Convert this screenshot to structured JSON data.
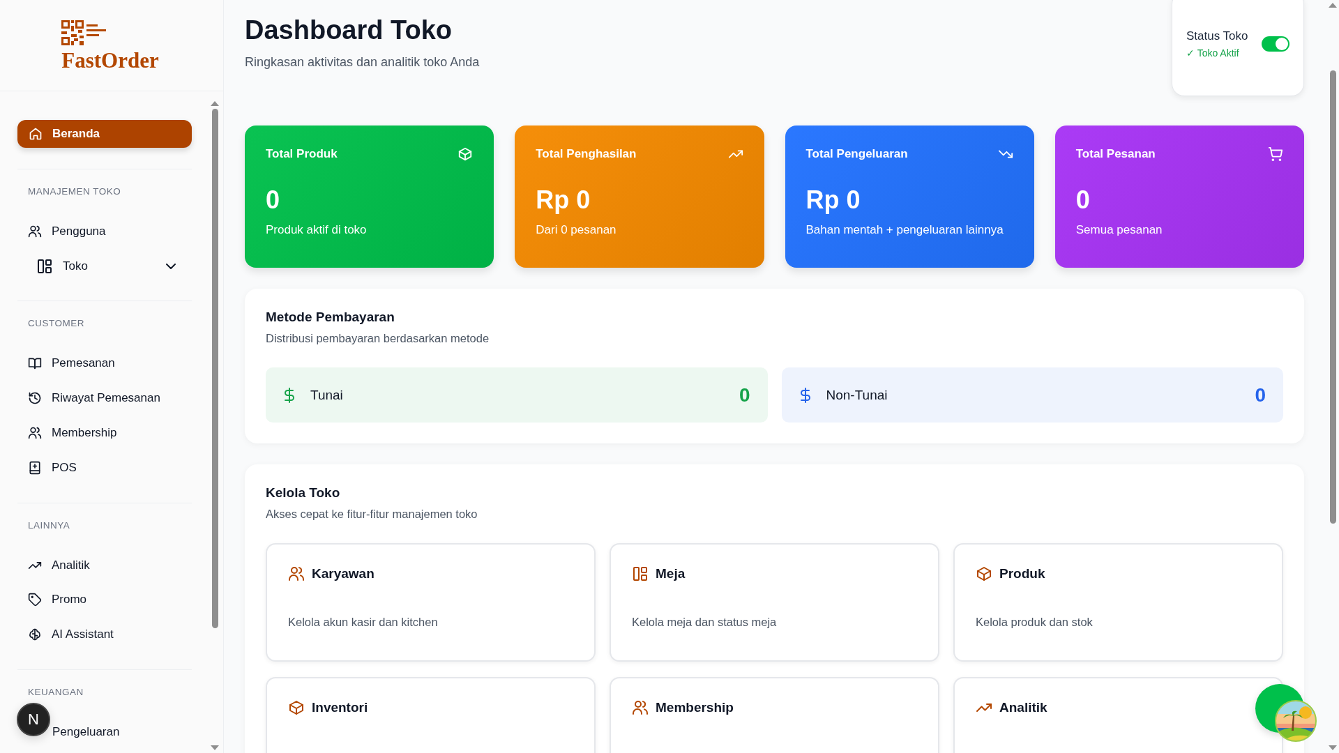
{
  "brand": {
    "name": "FastOrder"
  },
  "sidebar": {
    "home": {
      "label": "Beranda",
      "selected": true
    },
    "sections": [
      {
        "heading": "MANAJEMEN TOKO",
        "items": [
          {
            "kind": "link",
            "label": "Pengguna",
            "selected": false
          },
          {
            "kind": "group",
            "label": "Toko",
            "selected": false,
            "expanded": false
          }
        ]
      },
      {
        "heading": "CUSTOMER",
        "items": [
          {
            "kind": "link",
            "label": "Pemesanan",
            "selected": false
          },
          {
            "kind": "link",
            "label": "Riwayat Pemesanan",
            "selected": false
          },
          {
            "kind": "link",
            "label": "Membership",
            "selected": false
          },
          {
            "kind": "link",
            "label": "POS",
            "selected": false
          }
        ]
      },
      {
        "heading": "LAINNYA",
        "items": [
          {
            "kind": "link",
            "label": "Analitik",
            "selected": false
          },
          {
            "kind": "link",
            "label": "Promo",
            "selected": false
          },
          {
            "kind": "link",
            "label": "AI Assistant",
            "selected": false
          }
        ]
      },
      {
        "heading": "KEUANGAN",
        "items": [
          {
            "kind": "link",
            "label": "Pengeluaran",
            "selected": false
          }
        ]
      }
    ]
  },
  "header": {
    "title": "Dashboard Toko",
    "subtitle": "Ringkasan aktivitas dan analitik toko Anda"
  },
  "store_status": {
    "label": "Status Toko",
    "status": "✓ Toko Aktif",
    "on": true
  },
  "stats": [
    {
      "title": "Total Produk",
      "value": "0",
      "caption": "Produk aktif di toko",
      "color": "#00c04b"
    },
    {
      "title": "Total Penghasilan",
      "value": "Rp 0",
      "caption": "Dari 0 pesanan",
      "color": "#f58a00"
    },
    {
      "title": "Total Pengeluaran",
      "value": "Rp 0",
      "caption": "Bahan mentah + pengeluaran lainnya",
      "color": "#2272ff"
    },
    {
      "title": "Total Pesanan",
      "value": "0",
      "caption": "Semua pesanan",
      "color": "#a733f5"
    }
  ],
  "payment": {
    "title": "Metode Pembayaran",
    "subtitle": "Distribusi pembayaran berdasarkan metode",
    "methods": [
      {
        "label": "Tunai",
        "value": "0",
        "color": "#16a34a"
      },
      {
        "label": "Non-Tunai",
        "value": "0",
        "color": "#2563eb"
      }
    ]
  },
  "manage": {
    "title": "Kelola Toko",
    "subtitle": "Akses cepat ke fitur-fitur manajemen toko",
    "features": [
      {
        "title": "Karyawan",
        "description": "Kelola akun kasir dan kitchen"
      },
      {
        "title": "Meja",
        "description": "Kelola meja dan status meja"
      },
      {
        "title": "Produk",
        "description": "Kelola produk dan stok"
      },
      {
        "title": "Inventori"
      },
      {
        "title": "Membership"
      },
      {
        "title": "Analitik"
      }
    ]
  },
  "dev_badge": {
    "label": "N"
  }
}
